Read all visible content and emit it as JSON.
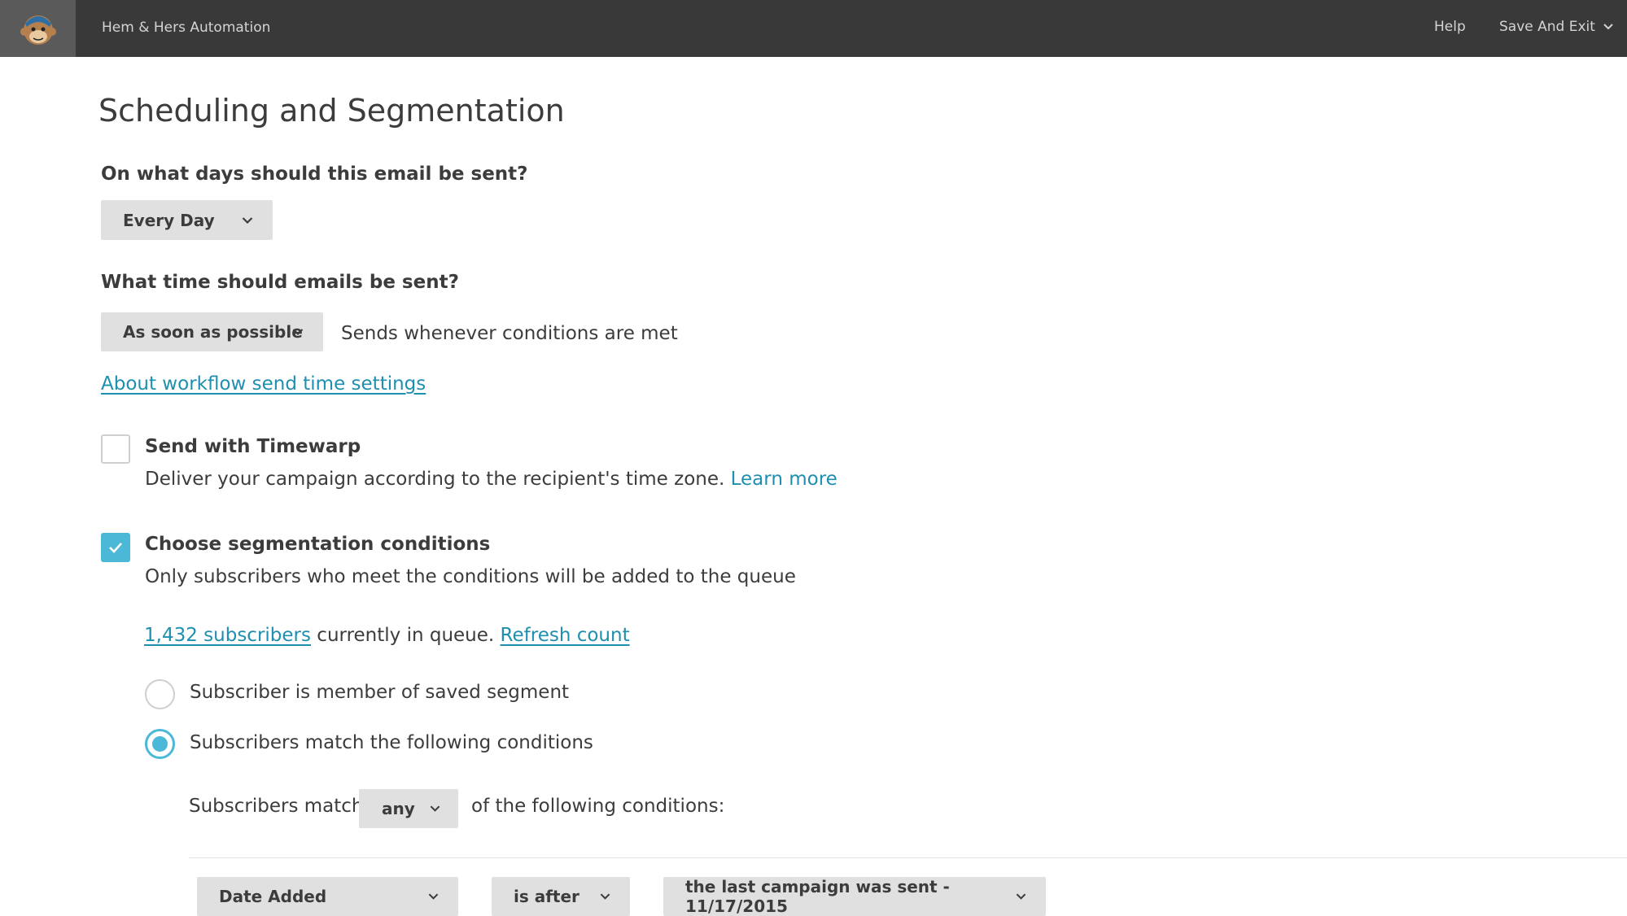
{
  "header": {
    "app_title": "Hem & Hers Automation",
    "help": "Help",
    "save_exit": "Save And Exit"
  },
  "page": {
    "title": "Scheduling and Segmentation"
  },
  "days": {
    "question": "On what days should this email be sent?",
    "selected": "Every Day"
  },
  "time": {
    "question": "What time should emails be sent?",
    "selected": "As soon as possible",
    "description": "Sends whenever conditions are met",
    "about_link": "About workflow send time settings"
  },
  "timewarp": {
    "checked": false,
    "label": "Send with Timewarp",
    "description": "Deliver your campaign according to the recipient's time zone.",
    "learn_more": "Learn more"
  },
  "segmentation": {
    "checked": true,
    "label": "Choose segmentation conditions",
    "description": "Only subscribers who meet the conditions will be added to the queue",
    "subscriber_count_link": "1,432 subscribers",
    "queue_text": "currently in queue.",
    "refresh_link": "Refresh count",
    "options": [
      {
        "label": "Subscriber is member of saved segment",
        "selected": false
      },
      {
        "label": "Subscribers match the following conditions",
        "selected": true
      }
    ],
    "match_prefix": "Subscribers match",
    "match_value": "any",
    "match_suffix": "of the following conditions:",
    "condition": {
      "field": "Date Added",
      "operator": "is after",
      "value": "the last campaign was sent - 11/17/2015"
    }
  },
  "colors": {
    "accent": "#4cb8d8",
    "link": "#1f8fb0",
    "topbar": "#393939"
  }
}
